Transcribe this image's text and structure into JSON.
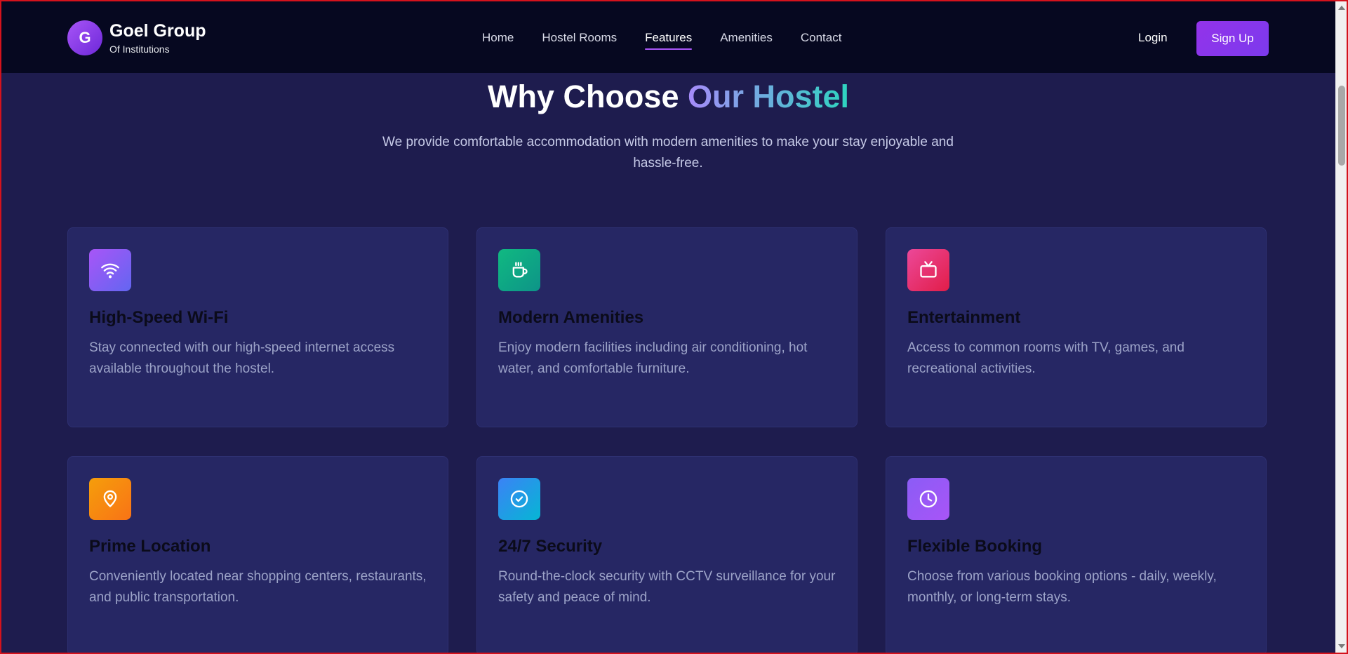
{
  "brand": {
    "logo_letter": "G",
    "name": "Goel Group",
    "subtitle": "Of Institutions"
  },
  "nav": {
    "items": [
      {
        "label": "Home"
      },
      {
        "label": "Hostel Rooms"
      },
      {
        "label": "Features",
        "active": true
      },
      {
        "label": "Amenities"
      },
      {
        "label": "Contact"
      }
    ],
    "login_label": "Login",
    "signup_label": "Sign Up"
  },
  "hero": {
    "title_plain": "Why Choose ",
    "title_highlight": "Our Hostel",
    "subtitle": "We provide comfortable accommodation with modern amenities to make your stay enjoyable and hassle-free."
  },
  "features": [
    {
      "icon": "wifi-icon",
      "color_from": "#a855f7",
      "color_to": "#6366f1",
      "title": "High-Speed Wi-Fi",
      "text": "Stay connected with our high-speed internet access available throughout the hostel."
    },
    {
      "icon": "coffee-icon",
      "color_from": "#10b981",
      "color_to": "#0d9488",
      "title": "Modern Amenities",
      "text": "Enjoy modern facilities including air conditioning, hot water, and comfortable furniture."
    },
    {
      "icon": "tv-icon",
      "color_from": "#ec4899",
      "color_to": "#e11d48",
      "title": "Entertainment",
      "text": "Access to common rooms with TV, games, and recreational activities."
    },
    {
      "icon": "location-pin-icon",
      "color_from": "#f59e0b",
      "color_to": "#f97316",
      "title": "Prime Location",
      "text": "Conveniently located near shopping centers, restaurants, and public transportation."
    },
    {
      "icon": "check-circle-icon",
      "color_from": "#3b82f6",
      "color_to": "#06b6d4",
      "title": "24/7 Security",
      "text": "Round-the-clock security with CCTV surveillance for your safety and peace of mind."
    },
    {
      "icon": "clock-icon",
      "color_from": "#8b5cf6",
      "color_to": "#a855f7",
      "title": "Flexible Booking",
      "text": "Choose from various booking options - daily, weekly, monthly, or long-term stays."
    }
  ]
}
